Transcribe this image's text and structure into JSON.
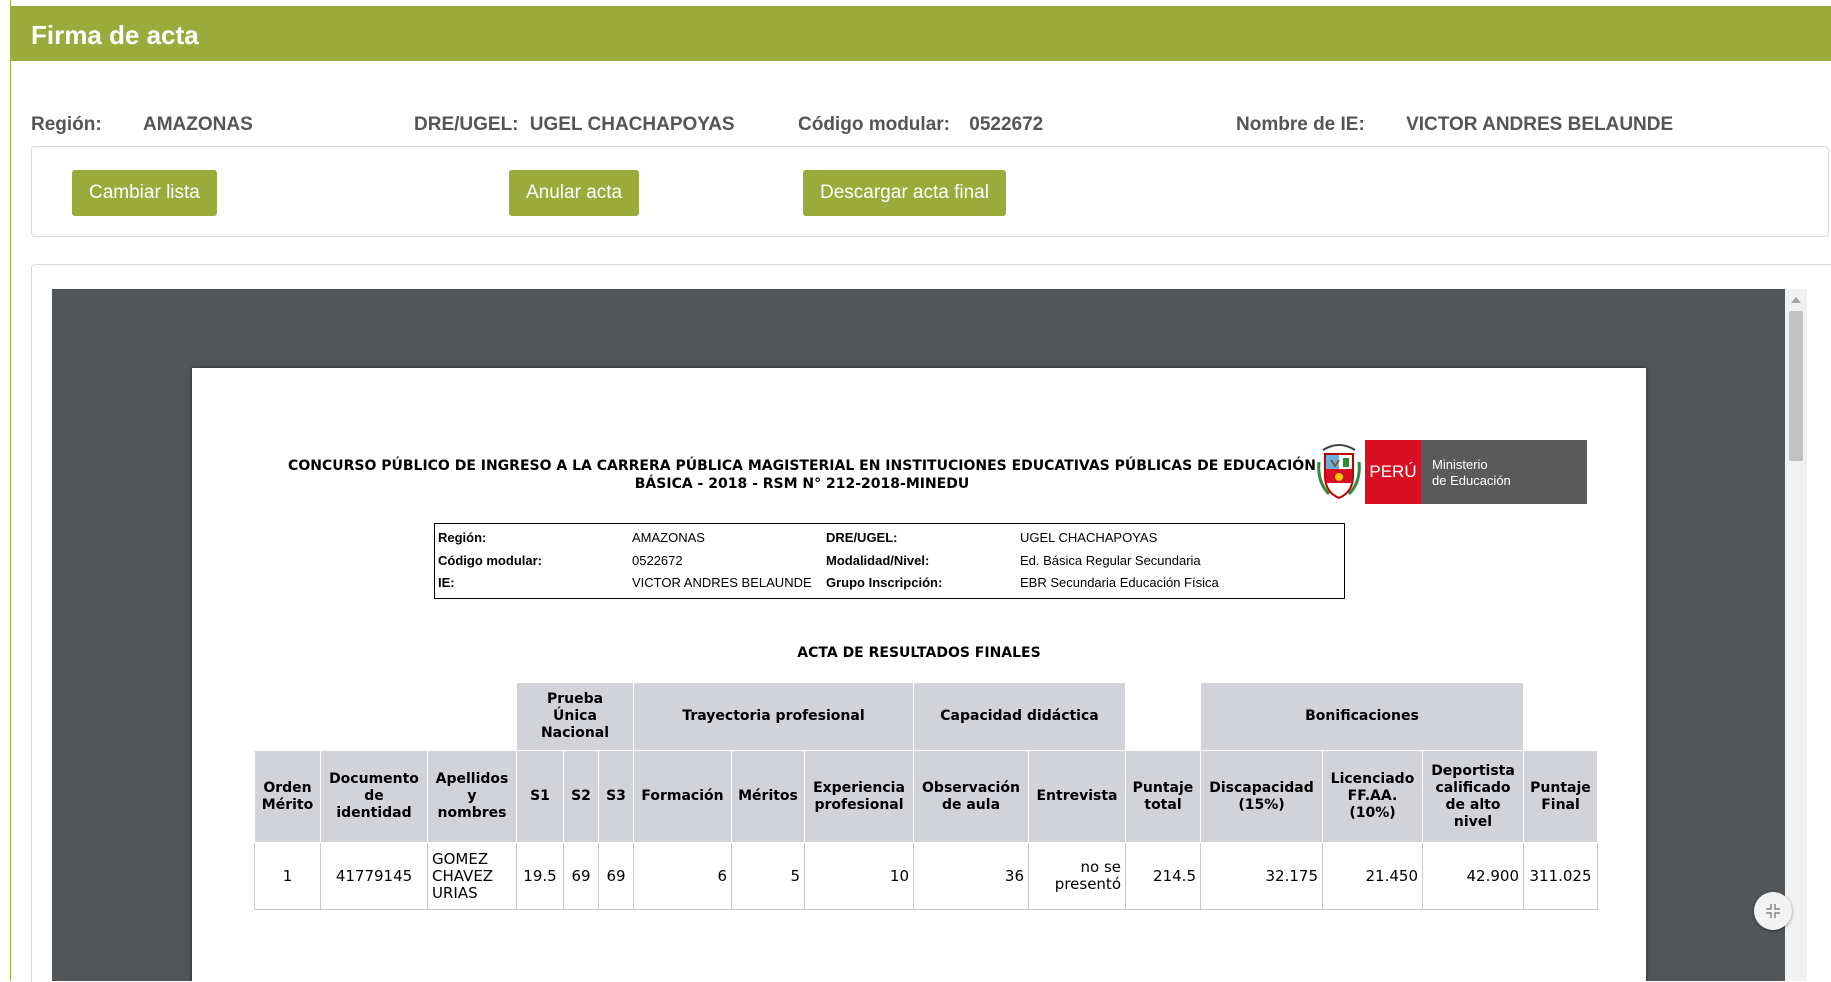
{
  "header": {
    "title": "Firma de acta"
  },
  "info": {
    "region_label": "Región:",
    "region_value": "AMAZONAS",
    "dre_label": "DRE/UGEL:",
    "dre_value": "UGEL CHACHAPOYAS",
    "codigo_label": "Código modular:",
    "codigo_value": "0522672",
    "nombre_label": "Nombre de IE:",
    "nombre_value": "VICTOR ANDRES BELAUNDE"
  },
  "buttons": {
    "cambiar": "Cambiar lista",
    "anular": "Anular acta",
    "descargar": "Descargar acta final"
  },
  "doc": {
    "title_line1": "CONCURSO PÚBLICO DE INGRESO A LA CARRERA PÚBLICA MAGISTERIAL EN INSTITUCIONES EDUCATIVAS PÚBLICAS DE EDUCACIÓN",
    "title_line2": "BÁSICA - 2018 - RSM N° 212-2018-MINEDU",
    "logo": {
      "peru": "PERÚ",
      "ministerio": "Ministerio",
      "educacion": "de Educación"
    },
    "box": {
      "region_l": "Región:",
      "region_v": "AMAZONAS",
      "dre_l": "DRE/UGEL:",
      "dre_v": "UGEL CHACHAPOYAS",
      "codigo_l": "Código modular:",
      "codigo_v": "0522672",
      "modalidad_l": "Modalidad/Nivel:",
      "modalidad_v": "Ed. Básica Regular Secundaria",
      "ie_l": "IE:",
      "ie_v": "VICTOR ANDRES BELAUNDE",
      "grupo_l": "Grupo Inscripción:",
      "grupo_v": "EBR Secundaria Educación Física"
    },
    "acta_title": "ACTA DE RESULTADOS FINALES",
    "groups": {
      "prueba_1": "Prueba",
      "prueba_2": "Única",
      "prueba_3": "Nacional",
      "trayectoria": "Trayectoria profesional",
      "capacidad": "Capacidad didáctica",
      "bonificaciones": "Bonificaciones"
    },
    "cols": {
      "orden_1": "Orden",
      "orden_2": "Mérito",
      "doc_1": "Documento",
      "doc_2": "de",
      "doc_3": "identidad",
      "ape_1": "Apellidos",
      "ape_2": "y",
      "ape_3": "nombres",
      "s1": "S1",
      "s2": "S2",
      "s3": "S3",
      "formacion": "Formación",
      "meritos": "Méritos",
      "exp_1": "Experiencia",
      "exp_2": "profesional",
      "obs_1": "Observación",
      "obs_2": "de aula",
      "entrevista": "Entrevista",
      "ptot_1": "Puntaje",
      "ptot_2": "total",
      "disc_1": "Discapacidad",
      "disc_2": "(15%)",
      "lic_1": "Licenciado",
      "lic_2": "FF.AA.",
      "lic_3": "(10%)",
      "dep_1": "Deportista",
      "dep_2": "calificado",
      "dep_3": "de alto",
      "dep_4": "nivel",
      "pfin_1": "Puntaje",
      "pfin_2": "Final"
    },
    "row": {
      "orden": "1",
      "documento": "41779145",
      "nombre_1": "GOMEZ",
      "nombre_2": "CHAVEZ",
      "nombre_3": "URIAS",
      "s1": "19.5",
      "s2": "69",
      "s3": "69",
      "formacion": "6",
      "meritos": "5",
      "experiencia": "10",
      "observacion": "36",
      "entrevista_1": "no se",
      "entrevista_2": "presentó",
      "puntaje_total": "214.5",
      "discapacidad": "32.175",
      "licenciado": "21.450",
      "deportista": "42.900",
      "puntaje_final": "311.025"
    }
  },
  "fab_icon": "compress-icon"
}
